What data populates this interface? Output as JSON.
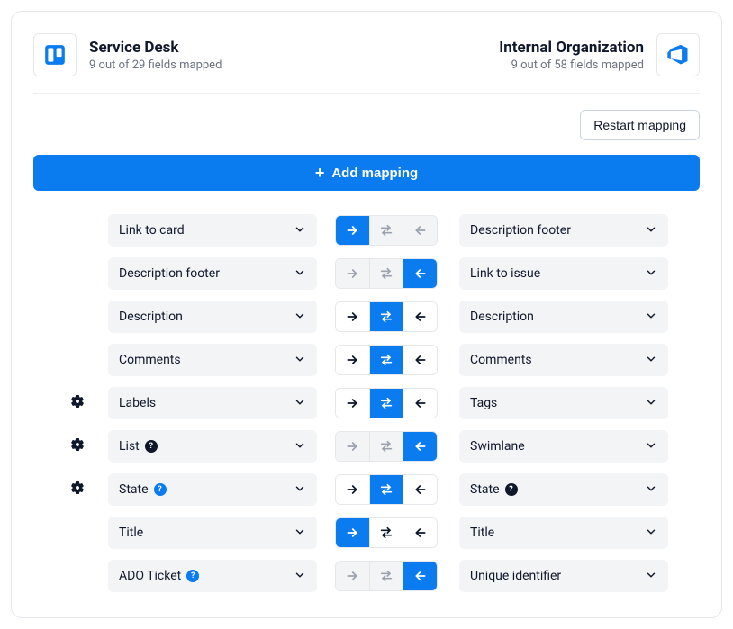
{
  "header": {
    "left": {
      "title": "Service Desk",
      "subtitle": "9 out of 29 fields mapped",
      "icon": "trello"
    },
    "right": {
      "title": "Internal Organization",
      "subtitle": "9 out of 58 fields mapped",
      "icon": "azure-devops"
    }
  },
  "toolbar": {
    "restart": "Restart mapping",
    "add_mapping": "Add mapping"
  },
  "rows": [
    {
      "gear": false,
      "left": {
        "label": "Link to card",
        "badge": null
      },
      "right": {
        "label": "Description footer",
        "badge": null
      },
      "dir": {
        "segments": [
          "right",
          "swap",
          "left"
        ],
        "active": "right",
        "disabled": [
          "swap",
          "left"
        ]
      }
    },
    {
      "gear": false,
      "left": {
        "label": "Description footer",
        "badge": null
      },
      "right": {
        "label": "Link to issue",
        "badge": null
      },
      "dir": {
        "segments": [
          "right",
          "swap",
          "left"
        ],
        "active": "left",
        "disabled": [
          "right",
          "swap"
        ]
      }
    },
    {
      "gear": false,
      "left": {
        "label": "Description",
        "badge": null
      },
      "right": {
        "label": "Description",
        "badge": null
      },
      "dir": {
        "segments": [
          "right",
          "swap",
          "left"
        ],
        "active": "swap",
        "disabled": []
      }
    },
    {
      "gear": false,
      "left": {
        "label": "Comments",
        "badge": null
      },
      "right": {
        "label": "Comments",
        "badge": null
      },
      "dir": {
        "segments": [
          "right",
          "swap",
          "left"
        ],
        "active": "swap",
        "disabled": []
      }
    },
    {
      "gear": true,
      "left": {
        "label": "Labels",
        "badge": null
      },
      "right": {
        "label": "Tags",
        "badge": null
      },
      "dir": {
        "segments": [
          "right",
          "swap",
          "left"
        ],
        "active": "swap",
        "disabled": []
      }
    },
    {
      "gear": true,
      "left": {
        "label": "List",
        "badge": "black"
      },
      "right": {
        "label": "Swimlane",
        "badge": null
      },
      "dir": {
        "segments": [
          "right",
          "swap",
          "left"
        ],
        "active": "left",
        "disabled": [
          "right",
          "swap"
        ]
      }
    },
    {
      "gear": true,
      "left": {
        "label": "State",
        "badge": "blue"
      },
      "right": {
        "label": "State",
        "badge": "black"
      },
      "dir": {
        "segments": [
          "right",
          "swap",
          "left"
        ],
        "active": "swap",
        "disabled": []
      }
    },
    {
      "gear": false,
      "left": {
        "label": "Title",
        "badge": null
      },
      "right": {
        "label": "Title",
        "badge": null
      },
      "dir": {
        "segments": [
          "right",
          "swap",
          "left"
        ],
        "active": "right",
        "disabled": []
      }
    },
    {
      "gear": false,
      "left": {
        "label": "ADO Ticket",
        "badge": "blue"
      },
      "right": {
        "label": "Unique identifier",
        "badge": null
      },
      "dir": {
        "segments": [
          "right",
          "swap",
          "left"
        ],
        "active": "left",
        "disabled": [
          "right",
          "swap"
        ]
      }
    }
  ],
  "colors": {
    "primary": "#0b7bf0"
  }
}
